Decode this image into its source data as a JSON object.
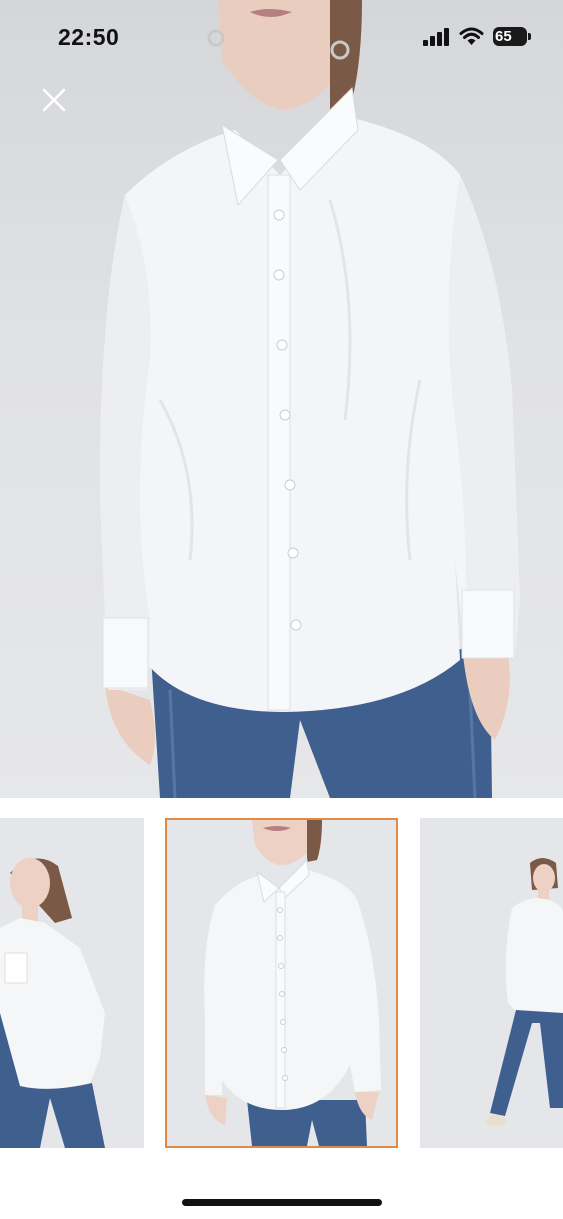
{
  "status_bar": {
    "time": "22:50",
    "battery": "65",
    "icons": [
      "cellular-signal-icon",
      "wifi-icon",
      "battery-icon"
    ]
  },
  "viewer": {
    "close_icon": "close-icon",
    "images_total": 3,
    "selected_index": 2
  },
  "colors": {
    "selected_thumb_border": "#e08a45",
    "background": "#ffffff"
  }
}
